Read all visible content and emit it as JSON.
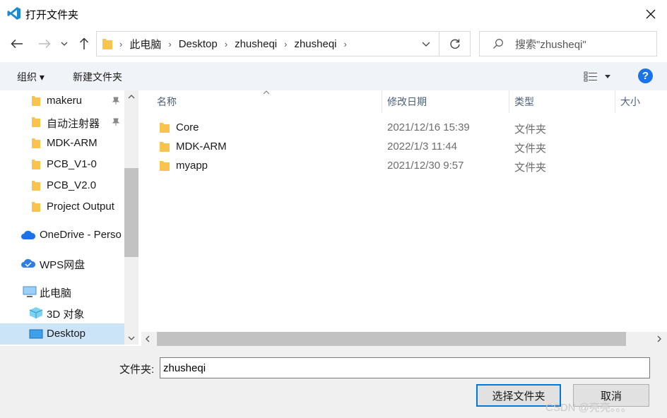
{
  "window": {
    "title": "打开文件夹"
  },
  "address": {
    "breadcrumbs": [
      "此电脑",
      "Desktop",
      "zhusheqi",
      "zhusheqi"
    ]
  },
  "search": {
    "placeholder": "搜索\"zhusheqi\""
  },
  "toolbar": {
    "organize": "组织 ▾",
    "new_folder": "新建文件夹"
  },
  "sidebar": {
    "items": [
      {
        "label": "makeru",
        "icon": "folder-icon",
        "pinned": true
      },
      {
        "label": "自动注射器",
        "icon": "folder-icon",
        "pinned": true
      },
      {
        "label": "MDK-ARM",
        "icon": "folder-icon"
      },
      {
        "label": "PCB_V1-0",
        "icon": "folder-icon"
      },
      {
        "label": "PCB_V2.0",
        "icon": "folder-icon"
      },
      {
        "label": "Project Output",
        "icon": "folder-icon"
      },
      {
        "label": "OneDrive - Perso",
        "icon": "onedrive-icon"
      },
      {
        "label": "WPS网盘",
        "icon": "wps-cloud-icon"
      },
      {
        "label": "此电脑",
        "icon": "this-pc-icon"
      },
      {
        "label": "3D 对象",
        "icon": "3d-objects-icon"
      },
      {
        "label": "Desktop",
        "icon": "desktop-icon",
        "selected": true
      }
    ]
  },
  "columns": {
    "name": "名称",
    "modified": "修改日期",
    "type": "类型",
    "size": "大小"
  },
  "files": [
    {
      "name": "Core",
      "modified": "2021/12/16 15:39",
      "type": "文件夹"
    },
    {
      "name": "MDK-ARM",
      "modified": "2022/1/3 11:44",
      "type": "文件夹"
    },
    {
      "name": "myapp",
      "modified": "2021/12/30 9:57",
      "type": "文件夹"
    }
  ],
  "footer": {
    "folder_label": "文件夹:",
    "folder_value": "zhusheqi",
    "select_button": "选择文件夹",
    "cancel_button": "取消"
  },
  "watermark": "CSDN @亮亮。。。",
  "colors": {
    "accent": "#0078d7",
    "folder": "#f8c44f",
    "selected_bg": "#cce4f7",
    "help": "#1a73e8"
  }
}
